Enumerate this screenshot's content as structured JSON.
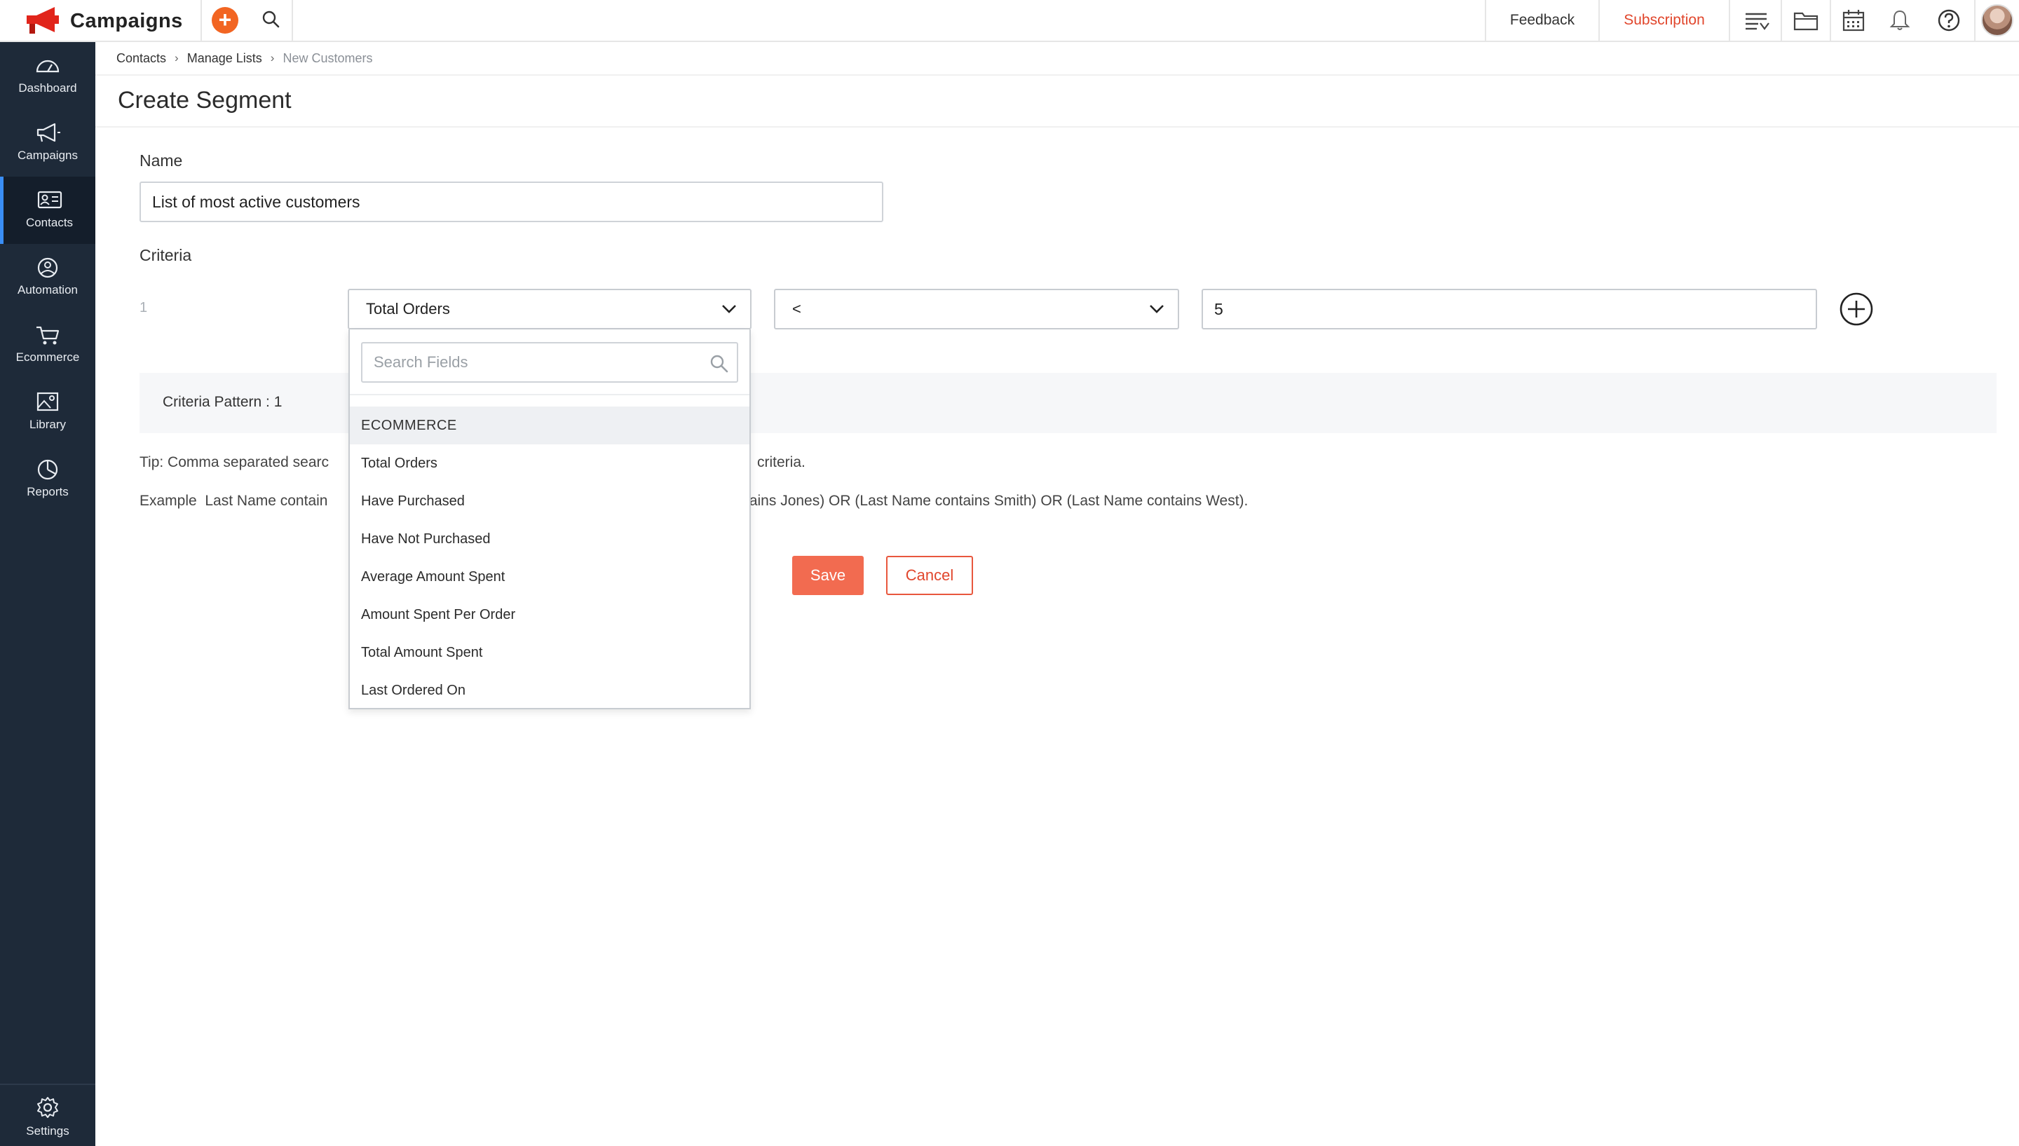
{
  "app": {
    "name": "Campaigns",
    "brand_color": "#f26522",
    "accent_color": "#3a8ef6"
  },
  "topbar": {
    "feedback_label": "Feedback",
    "subscription_label": "Subscription",
    "icons": [
      "list-filter-icon",
      "folder-icon",
      "calendar-icon",
      "bell-icon",
      "help-icon"
    ]
  },
  "sidebar": {
    "items": [
      {
        "label": "Dashboard",
        "icon": "dashboard-icon"
      },
      {
        "label": "Campaigns",
        "icon": "megaphone-icon"
      },
      {
        "label": "Contacts",
        "icon": "contact-card-icon",
        "active": true
      },
      {
        "label": "Automation",
        "icon": "automation-icon"
      },
      {
        "label": "Ecommerce",
        "icon": "cart-icon"
      },
      {
        "label": "Library",
        "icon": "image-library-icon"
      },
      {
        "label": "Reports",
        "icon": "pie-chart-icon"
      }
    ],
    "settings_label": "Settings"
  },
  "breadcrumb": {
    "items": [
      "Contacts",
      "Manage Lists",
      "New Customers"
    ]
  },
  "page": {
    "title": "Create Segment"
  },
  "form": {
    "name_label": "Name",
    "name_value": "List of most active customers",
    "criteria_label": "Criteria",
    "criteria": [
      {
        "number": "1",
        "field": "Total Orders",
        "operator": "<",
        "value": "5"
      }
    ],
    "pattern_text": "Criteria Pattern : 1",
    "tip_prefix": "Tip: Comma separated searc",
    "tip_suffix": "criteria.",
    "example_prefix": "Example  Last Name contain",
    "example_suffix": "tains Jones) OR (Last Name contains Smith) OR (Last Name contains West).",
    "save_label": "Save",
    "cancel_label": "Cancel"
  },
  "dropdown": {
    "search_placeholder": "Search Fields",
    "group_label": "ECOMMERCE",
    "options": [
      "Total Orders",
      "Have Purchased",
      "Have Not Purchased",
      "Average Amount Spent",
      "Amount Spent Per Order",
      "Total Amount Spent",
      "Last Ordered On"
    ]
  }
}
